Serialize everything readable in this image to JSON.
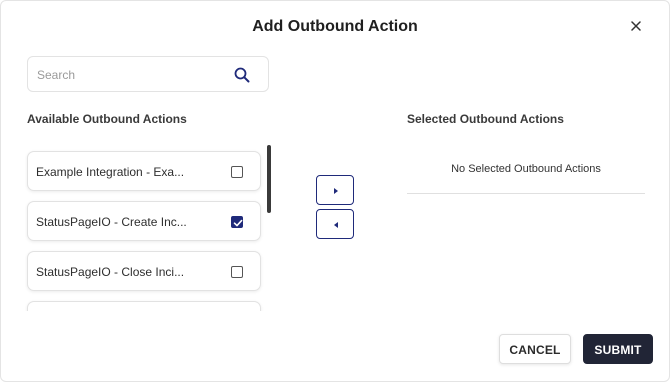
{
  "dialog": {
    "title": "Add Outbound Action",
    "close_icon": "close-icon"
  },
  "search": {
    "placeholder": "Search",
    "value": "",
    "icon": "search-icon"
  },
  "available": {
    "label": "Available Outbound Actions",
    "items": [
      {
        "label": "Example Integration - Exa...",
        "checked": false
      },
      {
        "label": "StatusPageIO - Create Inc...",
        "checked": true
      },
      {
        "label": "StatusPageIO - Close Inci...",
        "checked": false
      },
      {
        "label": "",
        "checked": false
      }
    ]
  },
  "move": {
    "right_icon": "caret-right-icon",
    "left_icon": "caret-left-icon"
  },
  "selected": {
    "label": "Selected Outbound Actions",
    "empty_text": "No Selected Outbound Actions"
  },
  "footer": {
    "cancel_label": "CANCEL",
    "submit_label": "SUBMIT"
  },
  "colors": {
    "accent": "#1f2a7a",
    "submit_bg": "#212536"
  }
}
